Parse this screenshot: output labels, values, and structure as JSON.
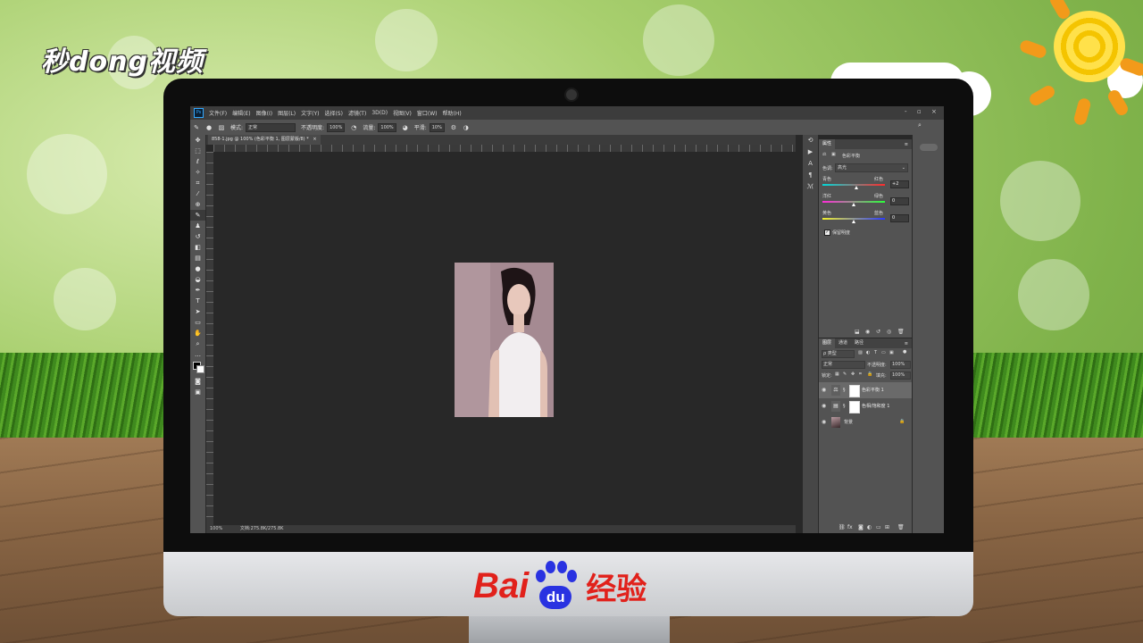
{
  "overlay": {
    "watermark_top": "秒dong视频",
    "brand_bai": "Bai",
    "brand_du": "du",
    "brand_jingyan": "经验"
  },
  "app": {
    "logo": "Ps",
    "menu": [
      "文件(F)",
      "编辑(E)",
      "图像(I)",
      "图层(L)",
      "文字(Y)",
      "选择(S)",
      "滤镜(T)",
      "3D(D)",
      "视图(V)",
      "窗口(W)",
      "帮助(H)"
    ],
    "window_controls": [
      "-",
      "▫",
      "×"
    ]
  },
  "options_bar": {
    "mode_label": "模式:",
    "mode_value": "正常",
    "opacity_label": "不透明度:",
    "opacity_value": "100%",
    "flow_label": "流量:",
    "flow_value": "100%",
    "smooth_label": "平滑:",
    "smooth_value": "10%"
  },
  "document": {
    "tab_title": "858-1.jpg @ 100% (色彩平衡 1, 图层蒙版/8) *",
    "tab_close": "×",
    "zoom": "100%",
    "doc_info": "文档:275.8K/275.8K"
  },
  "properties_panel": {
    "title": "属性",
    "adjustment_name": "色彩平衡",
    "tone_label": "色调:",
    "tone_value": "高光",
    "sliders": [
      {
        "left": "青色",
        "right": "红色",
        "value": "+2"
      },
      {
        "left": "洋红",
        "right": "绿色",
        "value": "0"
      },
      {
        "left": "黄色",
        "right": "蓝色",
        "value": "0"
      }
    ],
    "preserve_luminosity": "保留明度"
  },
  "layers_panel": {
    "tabs": [
      "图层",
      "通道",
      "路径"
    ],
    "filter_kind": "ρ 类型",
    "blend_mode": "正常",
    "opacity_label": "不透明度:",
    "opacity_value": "100%",
    "lock_label": "锁定:",
    "fill_label": "填充:",
    "fill_value": "100%",
    "layers": [
      {
        "name": "色彩平衡 1"
      },
      {
        "name": "色相/饱和度 1"
      },
      {
        "name": "背景"
      }
    ]
  }
}
